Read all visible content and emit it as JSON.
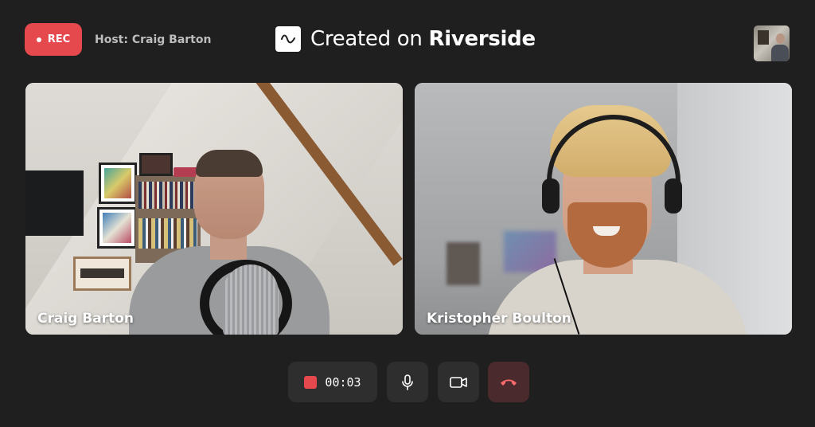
{
  "header": {
    "rec_label": "REC",
    "host_label": "Host: Craig Barton",
    "brand_prefix": "Created on ",
    "brand_name": "Riverside"
  },
  "participants": [
    {
      "name": "Craig Barton"
    },
    {
      "name": "Kristopher Boulton"
    }
  ],
  "controls": {
    "timer": "00:03",
    "icons": [
      "stop-square-icon",
      "microphone-icon",
      "video-camera-icon",
      "end-call-icon"
    ]
  },
  "colors": {
    "background": "#1f1f1f",
    "rec_red": "#e5484d",
    "control_bg": "#2e2e2e",
    "end_call_bg": "#4a2a2c",
    "end_call_icon": "#ff6b6b"
  }
}
